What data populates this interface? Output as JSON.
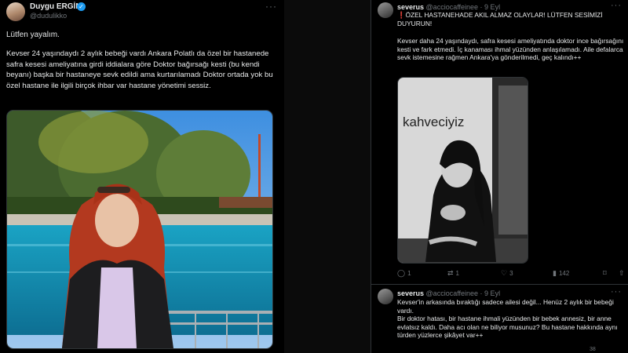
{
  "left_tweet": {
    "author_name": "Duygu ERGİN",
    "handle": "@dudulikko",
    "verified_icon": "verified-badge",
    "more_icon": "more-horizontal-icon",
    "greeting": "Lütfen yayalım.",
    "body": "Kevser 24 yaşındaydı 2 aylık bebeği vardı Ankara Polatlı da özel bir hastanede safra kesesi ameliyatına girdi iddialara göre Doktor bağırsağı kesti (bu kendi beyanı) başka bir hastaneye sevk edildi ama kurtarılamadı Doktor ortada yok bu özel hastane ile ilgili birçok ihbar var hastane yönetimi sessiz."
  },
  "right_tweet_1": {
    "author_name": "severus",
    "meta": "@acciocaffeinee · 9 Eyl",
    "more_icon": "more-horizontal-icon",
    "alert_icon": "❗",
    "headline": "ÖZEL HASTANEHADE AKIL ALMAZ OLAYLAR! LÜTFEN SESİMİZİ DUYURUN!",
    "body": "Kevser daha 24 yaşındaydı, safra kesesi ameliyatında doktor ince bağırsağını kesti ve fark etmedi. İç kanaması ihmal yüzünden anlaşılamadı. Aile defalarca sevk istemesine rağmen Ankara'ya gönderilmedi, geç kalındı++",
    "media_sign_text": "kahveciyiz",
    "actions": {
      "reply_count": "1",
      "retweet_count": "1",
      "like_count": "3",
      "views_count": "142"
    }
  },
  "right_tweet_2": {
    "author_name": "severus",
    "meta": "@acciocaffeinee · 9 Eyl",
    "more_icon": "more-horizontal-icon",
    "body_1": "Kevser'in arkasında bıraktığı sadece ailesi değil... Henüz 2 aylık bir bebeği vardı.",
    "body_2": "Bir doktor hatası, bir hastane ihmali yüzünden bir bebek annesiz, bir anne evlatsız kaldı. Daha acı olan ne biliyor musunuz? Bu hastane hakkında aynı türden yüzlerce şikâyet var++",
    "bottom_partial": "38"
  },
  "colors": {
    "background": "#000000",
    "text": "#e7e9ea",
    "muted": "#71767b",
    "verified_blue": "#1d9bf0",
    "alert_red": "#f4212e",
    "border": "#2f3336"
  }
}
